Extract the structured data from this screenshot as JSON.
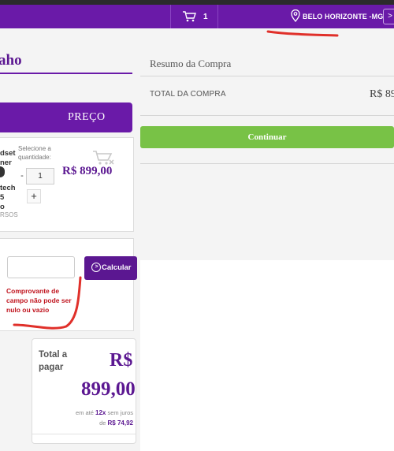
{
  "header": {
    "cart_count": "1",
    "location": "BELO HORIZONTE -MG",
    "next_symbol": ">"
  },
  "page": {
    "title": "aho"
  },
  "cart_table": {
    "price_header": "PREÇO"
  },
  "product": {
    "name_top": "dset\nner",
    "name_bottom": "tech\n5\no",
    "tag": "RSOS",
    "qty_label": "Selecione a quantidade:",
    "qty_minus": "-",
    "qty_value": "1",
    "qty_plus": "+",
    "price": "R$ 899,00"
  },
  "shipping": {
    "cep_value": "",
    "calc_label": "Calcular",
    "error": "Comprovante de campo não pode ser nulo ou vazio"
  },
  "total_card": {
    "label": "Total a pagar",
    "currency": "R$",
    "value": "899,00",
    "installments_prefix": "em até",
    "installments_count": "12x",
    "installments_mid": "sem juros de",
    "installments_value": "R$ 74,92"
  },
  "summary": {
    "title": "Resumo da Compra",
    "total_label": "TOTAL DA COMPRA",
    "total_value": "R$ 89",
    "continue_label": "Continuar"
  },
  "colors": {
    "brand_purple": "#6a1aa8",
    "continue_green": "#78c246",
    "error_red": "#c0141e",
    "annotation_red": "#e0302a"
  }
}
